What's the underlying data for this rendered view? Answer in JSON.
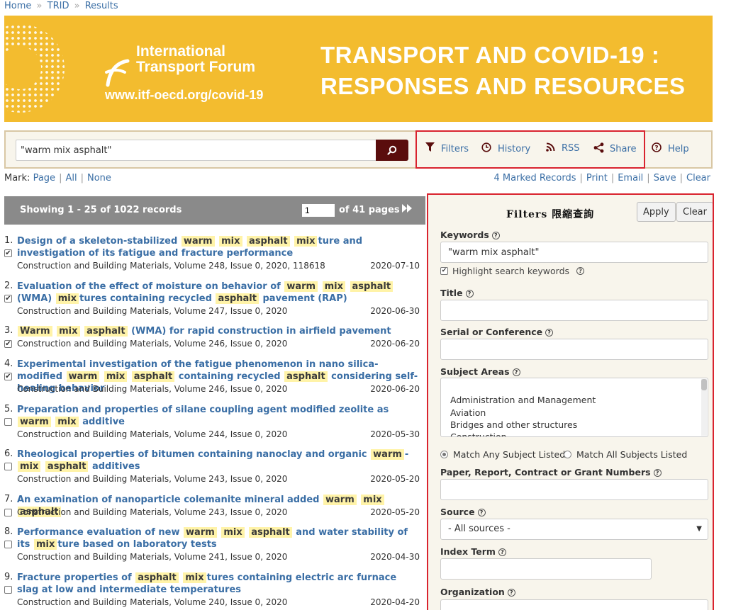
{
  "breadcrumb": {
    "home": "Home",
    "sep": "»",
    "trid": "TRID",
    "results": "Results"
  },
  "banner": {
    "org_line1": "International",
    "org_line2": "Transport Forum",
    "url": "www.itf-oecd.org/covid-19",
    "headline_line1": "TRANSPORT AND COVID-19 :",
    "headline_line2": "RESPONSES AND RESOURCES",
    "color": "#f3bc2f"
  },
  "search": {
    "value": "\"warm mix asphalt\"",
    "button_icon": "search-icon"
  },
  "toolbar": {
    "filters": "Filters",
    "history": "History",
    "rss": "RSS",
    "share": "Share",
    "help": "Help"
  },
  "mark": {
    "label": "Mark:",
    "page": "Page",
    "all": "All",
    "none": "None"
  },
  "record_actions": {
    "marked": "4 Marked Records",
    "print": "Print",
    "email": "Email",
    "save": "Save",
    "clear": "Clear"
  },
  "results_header": {
    "showing": "Showing 1 - 25 of 1022 records",
    "page": "1",
    "of_pages": "of 41 pages"
  },
  "results": [
    {
      "num": "1.",
      "title_html": "Design of a skeleton-stabilized <span class='hl'>warm</span> <span class='hl'>mix</span> <span class='hl'>asphalt</span> <span class='hl'>mix</span>ture and investigation of its fatigue and fracture performance",
      "source": "Construction and Building Materials, Volume 248, Issue 0, 2020, 118618",
      "date": "2020-07-10",
      "checked": true
    },
    {
      "num": "2.",
      "title_html": "Evaluation of the effect of moisture on behavior of <span class='hl'>warm</span> <span class='hl'>mix</span> <span class='hl'>asphalt</span> (WMA) <span class='hl'>mix</span>tures containing recycled <span class='hl'>asphalt</span> pavement (RAP)",
      "source": "Construction and Building Materials, Volume 247, Issue 0, 2020",
      "date": "2020-06-30",
      "checked": true
    },
    {
      "num": "3.",
      "title_html": "<span class='hl'>Warm</span> <span class='hl'>mix</span> <span class='hl'>asphalt</span> (WMA) for rapid construction in airfield pavement",
      "source": "Construction and Building Materials, Volume 246, Issue 0, 2020",
      "date": "2020-06-20",
      "checked": true
    },
    {
      "num": "4.",
      "title_html": "Experimental investigation of the fatigue phenomenon in nano silica-modified <span class='hl'>warm</span> <span class='hl'>mix</span> <span class='hl'>asphalt</span> containing recycled <span class='hl'>asphalt</span> considering self-healing behavior",
      "source": "Construction and Building Materials, Volume 246, Issue 0, 2020",
      "date": "2020-06-20",
      "checked": true
    },
    {
      "num": "5.",
      "title_html": "Preparation and properties of silane coupling agent modified zeolite as <span class='hl'>warm</span> <span class='hl'>mix</span> additive",
      "source": "Construction and Building Materials, Volume 244, Issue 0, 2020",
      "date": "2020-05-30",
      "checked": false
    },
    {
      "num": "6.",
      "title_html": "Rheological properties of bitumen containing nanoclay and organic <span class='hl'>warm</span>-<span class='hl'>mix</span> <span class='hl'>asphalt</span> additives",
      "source": "Construction and Building Materials, Volume 243, Issue 0, 2020",
      "date": "2020-05-20",
      "checked": false
    },
    {
      "num": "7.",
      "title_html": "An examination of nanoparticle colemanite mineral added <span class='hl'>warm</span> <span class='hl'>mix</span> <span class='hl'>asphalt</span>",
      "source": "Construction and Building Materials, Volume 243, Issue 0, 2020",
      "date": "2020-05-20",
      "checked": false
    },
    {
      "num": "8.",
      "title_html": "Performance evaluation of new <span class='hl'>warm</span> <span class='hl'>mix</span> <span class='hl'>asphalt</span> and water stability of its <span class='hl'>mix</span>ture based on laboratory tests",
      "source": "Construction and Building Materials, Volume 241, Issue 0, 2020",
      "date": "2020-04-30",
      "checked": false
    },
    {
      "num": "9.",
      "title_html": "Fracture properties of <span class='hl'>asphalt</span> <span class='hl'>mix</span>tures containing electric arc furnace slag at low and intermediate temperatures",
      "source": "Construction and Building Materials, Volume 240, Issue 0, 2020",
      "date": "2020-04-20",
      "checked": false
    }
  ],
  "filters": {
    "title": "Filters 限縮查詢",
    "apply": "Apply",
    "clear": "Clear",
    "keywords_label": "Keywords",
    "keywords_value": "\"warm mix asphalt\"",
    "highlight_label": "Highlight search keywords",
    "title_label": "Title",
    "serial_label": "Serial or Conference",
    "subject_label": "Subject Areas",
    "subjects": [
      "Administration and Management",
      "Aviation",
      "Bridges and other structures",
      "Construction"
    ],
    "match_any": "Match Any Subject Listed",
    "match_all": "Match All Subjects Listed",
    "paper_label": "Paper, Report, Contract or Grant Numbers",
    "source_label": "Source",
    "source_value": "- All sources -",
    "index_label": "Index Term",
    "org_label": "Organization"
  },
  "colors": {
    "link": "#3a6ea5",
    "highlight_box": "#d9232e",
    "search_button": "#5a0d0d",
    "keyword_highlight": "#fff3a8"
  }
}
